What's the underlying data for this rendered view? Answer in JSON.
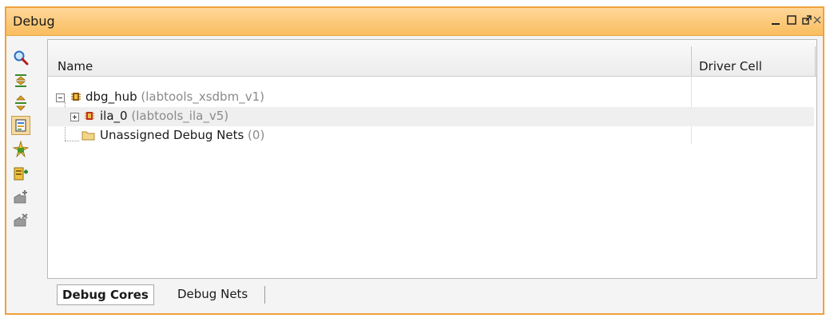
{
  "window": {
    "title": "Debug",
    "controls": [
      "minimize-icon",
      "maximize-icon",
      "restore-icon",
      "close-icon"
    ]
  },
  "toolbar": {
    "items": [
      {
        "name": "search-icon",
        "active": false
      },
      {
        "name": "collapse-all-icon",
        "active": false
      },
      {
        "name": "expand-all-icon",
        "active": false
      },
      {
        "name": "show-nets-icon",
        "active": true
      },
      {
        "name": "auto-assign-icon",
        "active": false
      },
      {
        "name": "add-probe-icon",
        "active": false
      },
      {
        "name": "add-net-icon",
        "active": false
      },
      {
        "name": "remove-net-icon",
        "active": false
      }
    ]
  },
  "table": {
    "columns": [
      "Name",
      "Driver Cell"
    ],
    "rows": [
      {
        "name": "dbg_hub",
        "detail": "(labtools_xsdbm_v1)",
        "driver": "",
        "icon": "chip-icon",
        "expanded": true
      },
      {
        "name": "ila_0",
        "detail": "(labtools_ila_v5)",
        "driver": "",
        "icon": "chip-red-icon",
        "expanded": false
      },
      {
        "name": "Unassigned Debug Nets",
        "detail": "(0)",
        "driver": "",
        "icon": "folder-icon"
      }
    ]
  },
  "tabs": [
    {
      "label": "Debug Cores",
      "active": true
    },
    {
      "label": "Debug Nets",
      "active": false
    }
  ],
  "colors": {
    "title_gradient_top": "#ffd79a",
    "title_gradient_bottom": "#f9bd5e",
    "border_orange": "#f0a13a"
  }
}
